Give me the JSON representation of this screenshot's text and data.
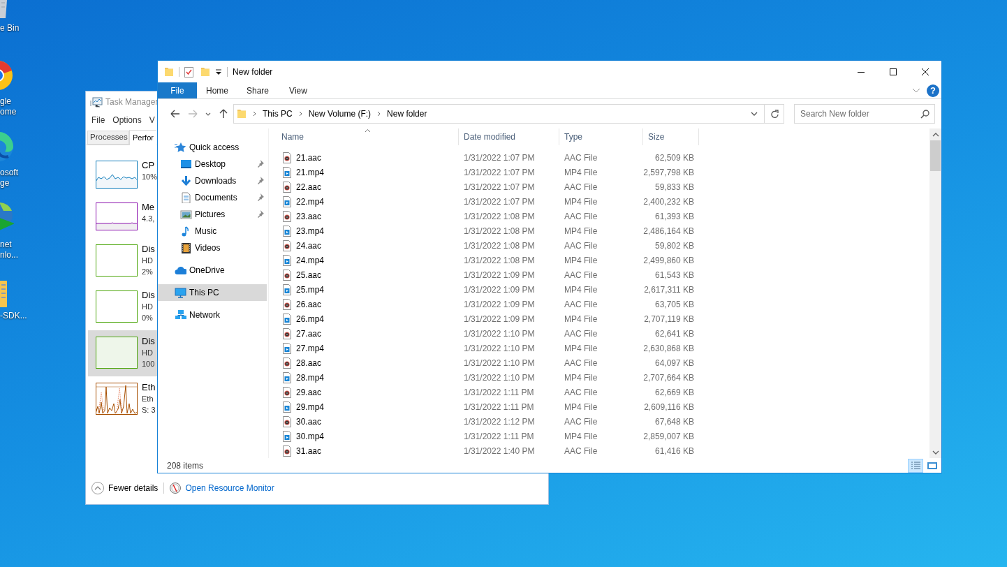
{
  "desktop": {
    "icons": [
      {
        "kind": "bin",
        "label": "e Bin"
      },
      {
        "kind": "ring",
        "label": "gle\nome"
      },
      {
        "kind": "swirl",
        "label": "osoft\nge"
      },
      {
        "kind": "globe",
        "label": "net\nnlo..."
      },
      {
        "kind": "archive",
        "label": "-SDK..."
      }
    ]
  },
  "task_manager": {
    "title": "Task Manager",
    "menu": [
      "File",
      "Options",
      "V"
    ],
    "tabs": [
      {
        "label": "Processes",
        "selected": false
      },
      {
        "label": "Perfor",
        "selected": true
      }
    ],
    "items": [
      {
        "kind": "cpu",
        "color": "#117dbb",
        "lines": [
          "CP",
          "10%"
        ],
        "selected": false
      },
      {
        "kind": "memory",
        "color": "#8b12ae",
        "lines": [
          "Me",
          "4.3,"
        ],
        "selected": false
      },
      {
        "kind": "disk",
        "color": "#4da60c",
        "lines": [
          "Dis",
          "HD",
          "2%"
        ],
        "selected": false
      },
      {
        "kind": "disk",
        "color": "#4da60c",
        "lines": [
          "Dis",
          "HD",
          "0%"
        ],
        "selected": false
      },
      {
        "kind": "busydisk",
        "color": "#4da60c",
        "lines": [
          "Dis",
          "HD",
          "100"
        ],
        "selected": true
      },
      {
        "kind": "network",
        "color": "#a74f01",
        "lines": [
          "Eth",
          "Eth",
          "S: 3"
        ],
        "selected": false
      }
    ],
    "fewer_details": "Fewer details",
    "resource_link": "Open Resource Monitor"
  },
  "explorer": {
    "title": "New folder",
    "file_button": "File",
    "ribbon_tabs": [
      {
        "label": "Home",
        "selected": false
      },
      {
        "label": "Share",
        "selected": false
      },
      {
        "label": "View",
        "selected": false
      }
    ],
    "help": "?",
    "crumbs": [
      "This PC",
      "New Volume (F:)",
      "New folder"
    ],
    "search": {
      "placeholder": "Search New folder"
    },
    "nav": [
      {
        "kind": "star",
        "label": "Quick access",
        "selected": false,
        "children": [
          {
            "kind": "desktop",
            "label": "Desktop",
            "pinned": true,
            "selected": false
          },
          {
            "kind": "downloads",
            "label": "Downloads",
            "pinned": true,
            "selected": false
          },
          {
            "kind": "documents",
            "label": "Documents",
            "pinned": true,
            "selected": false
          },
          {
            "kind": "pictures",
            "label": "Pictures",
            "pinned": true,
            "selected": false
          },
          {
            "kind": "music",
            "label": "Music",
            "pinned": false,
            "selected": false
          },
          {
            "kind": "videos",
            "label": "Videos",
            "pinned": false,
            "selected": false
          }
        ]
      },
      {
        "kind": "cloud",
        "label": "OneDrive",
        "selected": false
      },
      {
        "kind": "pc",
        "label": "This PC",
        "selected": true
      },
      {
        "kind": "network",
        "label": "Network",
        "selected": false
      }
    ],
    "columns": [
      "Name",
      "Date modified",
      "Type",
      "Size"
    ],
    "rows": [
      {
        "kind": "audio",
        "name": "21.aac",
        "date": "1/31/2022 1:07 PM",
        "type": "AAC File",
        "size": "62,509 KB",
        "selected": false
      },
      {
        "kind": "video",
        "name": "21.mp4",
        "date": "1/31/2022 1:07 PM",
        "type": "MP4 File",
        "size": "2,597,798 KB",
        "selected": false
      },
      {
        "kind": "audio",
        "name": "22.aac",
        "date": "1/31/2022 1:07 PM",
        "type": "AAC File",
        "size": "59,833 KB",
        "selected": false
      },
      {
        "kind": "video",
        "name": "22.mp4",
        "date": "1/31/2022 1:07 PM",
        "type": "MP4 File",
        "size": "2,400,232 KB",
        "selected": false
      },
      {
        "kind": "audio",
        "name": "23.aac",
        "date": "1/31/2022 1:08 PM",
        "type": "AAC File",
        "size": "61,393 KB",
        "selected": false
      },
      {
        "kind": "video",
        "name": "23.mp4",
        "date": "1/31/2022 1:08 PM",
        "type": "MP4 File",
        "size": "2,486,164 KB",
        "selected": false
      },
      {
        "kind": "audio",
        "name": "24.aac",
        "date": "1/31/2022 1:08 PM",
        "type": "AAC File",
        "size": "59,802 KB",
        "selected": false
      },
      {
        "kind": "video",
        "name": "24.mp4",
        "date": "1/31/2022 1:08 PM",
        "type": "MP4 File",
        "size": "2,499,860 KB",
        "selected": false
      },
      {
        "kind": "audio",
        "name": "25.aac",
        "date": "1/31/2022 1:09 PM",
        "type": "AAC File",
        "size": "61,543 KB",
        "selected": false
      },
      {
        "kind": "video",
        "name": "25.mp4",
        "date": "1/31/2022 1:09 PM",
        "type": "MP4 File",
        "size": "2,617,311 KB",
        "selected": false
      },
      {
        "kind": "audio",
        "name": "26.aac",
        "date": "1/31/2022 1:09 PM",
        "type": "AAC File",
        "size": "63,705 KB",
        "selected": false
      },
      {
        "kind": "video",
        "name": "26.mp4",
        "date": "1/31/2022 1:09 PM",
        "type": "MP4 File",
        "size": "2,707,119 KB",
        "selected": false
      },
      {
        "kind": "audio",
        "name": "27.aac",
        "date": "1/31/2022 1:10 PM",
        "type": "AAC File",
        "size": "62,641 KB",
        "selected": false
      },
      {
        "kind": "video",
        "name": "27.mp4",
        "date": "1/31/2022 1:10 PM",
        "type": "MP4 File",
        "size": "2,630,868 KB",
        "selected": false
      },
      {
        "kind": "audio",
        "name": "28.aac",
        "date": "1/31/2022 1:10 PM",
        "type": "AAC File",
        "size": "64,097 KB",
        "selected": false
      },
      {
        "kind": "video",
        "name": "28.mp4",
        "date": "1/31/2022 1:10 PM",
        "type": "MP4 File",
        "size": "2,707,664 KB",
        "selected": false
      },
      {
        "kind": "audio",
        "name": "29.aac",
        "date": "1/31/2022 1:11 PM",
        "type": "AAC File",
        "size": "62,669 KB",
        "selected": false
      },
      {
        "kind": "video",
        "name": "29.mp4",
        "date": "1/31/2022 1:11 PM",
        "type": "MP4 File",
        "size": "2,609,116 KB",
        "selected": false
      },
      {
        "kind": "audio",
        "name": "30.aac",
        "date": "1/31/2022 1:12 PM",
        "type": "AAC File",
        "size": "67,648 KB",
        "selected": false
      },
      {
        "kind": "video",
        "name": "30.mp4",
        "date": "1/31/2022 1:11 PM",
        "type": "MP4 File",
        "size": "2,859,007 KB",
        "selected": false
      },
      {
        "kind": "audio",
        "name": "31.aac",
        "date": "1/31/2022 1:40 PM",
        "type": "AAC File",
        "size": "61,416 KB",
        "selected": false
      }
    ],
    "status": "208 items",
    "view_modes": [
      {
        "kind": "details",
        "selected": true
      },
      {
        "kind": "thumbnails",
        "selected": false
      }
    ]
  }
}
